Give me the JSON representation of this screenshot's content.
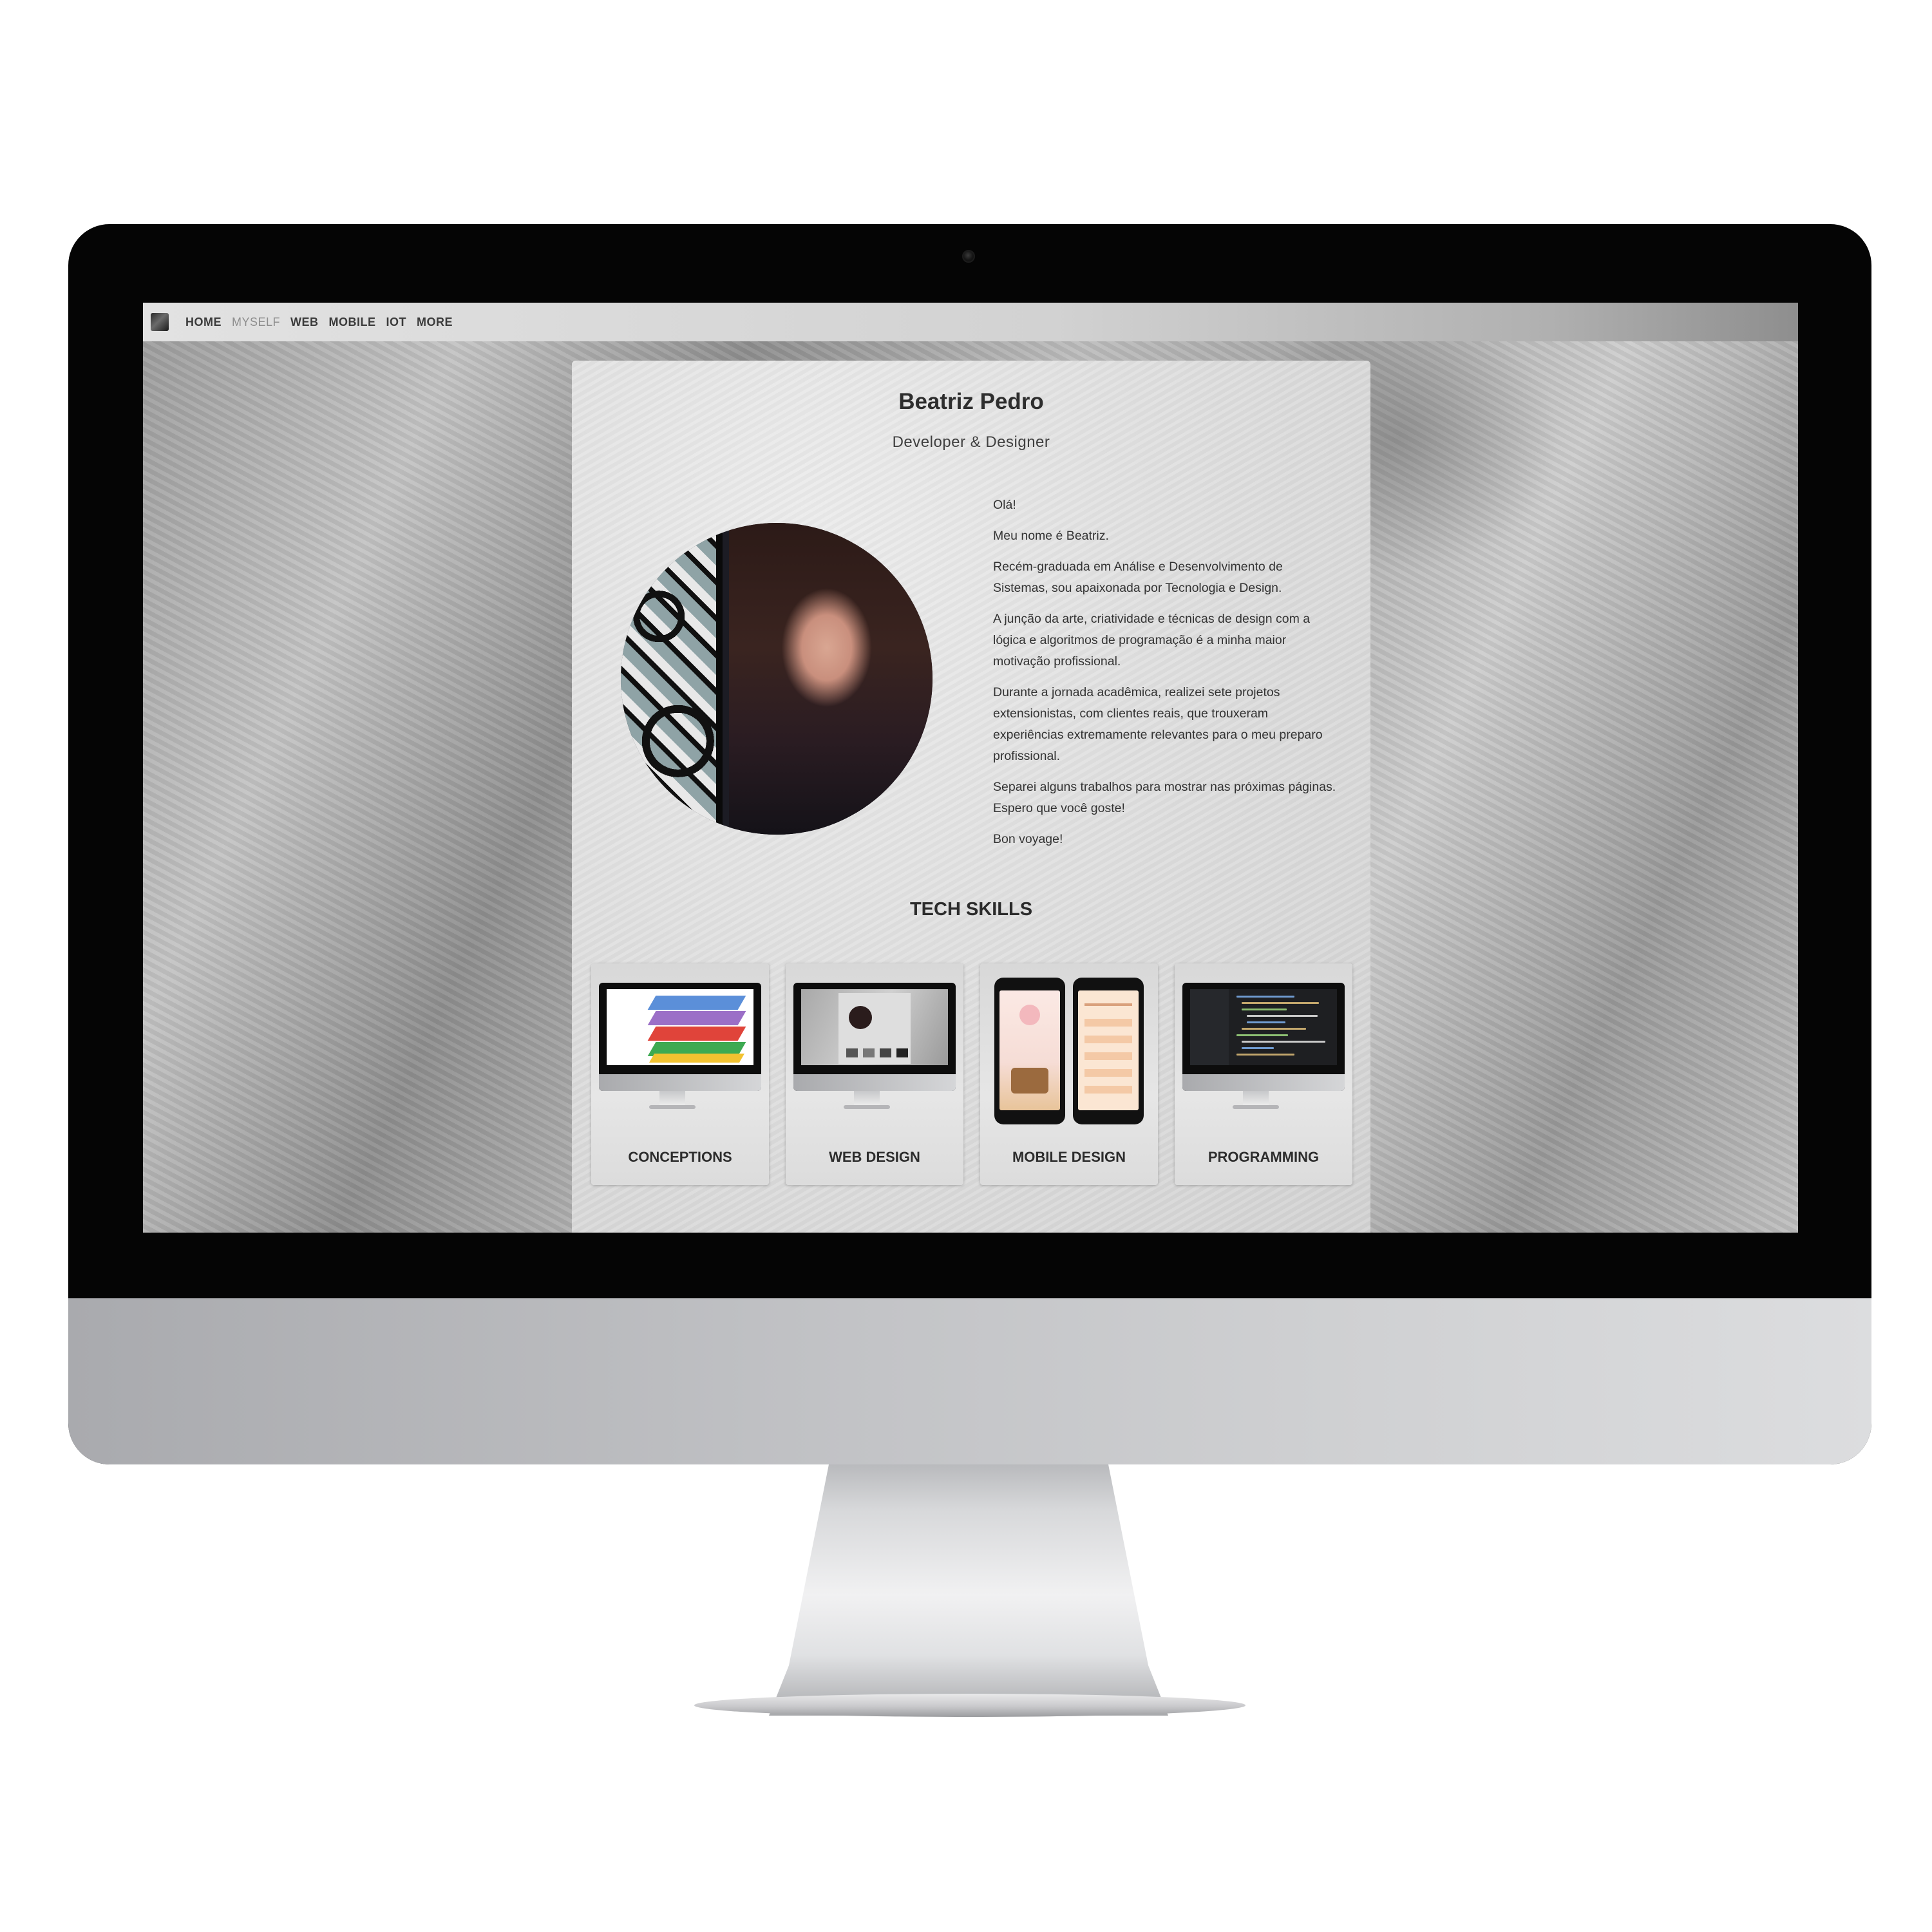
{
  "nav": {
    "items": [
      {
        "label": "HOME",
        "active": false
      },
      {
        "label": "MYSELF",
        "active": true
      },
      {
        "label": "WEB",
        "active": false
      },
      {
        "label": "MOBILE",
        "active": false
      },
      {
        "label": "IOT",
        "active": false
      },
      {
        "label": "MORE",
        "active": false
      }
    ]
  },
  "profile": {
    "name": "Beatriz Pedro",
    "role": "Developer & Designer"
  },
  "bio": [
    "Olá!",
    "Meu nome é Beatriz.",
    "Recém-graduada em Análise e Desenvolvimento de Sistemas, sou apaixonada por Tecnologia e Design.",
    "A junção da arte, criatividade e técnicas de design com a lógica e algoritmos de programação é a minha maior motivação profissional.",
    "Durante a jornada acadêmica, realizei sete projetos extensionistas, com clientes reais, que trouxeram experiências extremamente relevantes para o meu preparo profissional.",
    "Separei alguns trabalhos para mostrar nas próximas páginas. Espero que você goste!",
    "Bon voyage!"
  ],
  "skills": {
    "title": "TECH SKILLS",
    "tiles": [
      {
        "label": "CONCEPTIONS"
      },
      {
        "label": "WEB DESIGN"
      },
      {
        "label": "MOBILE DESIGN"
      },
      {
        "label": "PROGRAMMING"
      }
    ]
  },
  "colors": {
    "monitor_bezel": "#050505",
    "nav_text": "#3b3b3b",
    "nav_active": "#8d8d8d",
    "card_bg": "#dddddd"
  }
}
